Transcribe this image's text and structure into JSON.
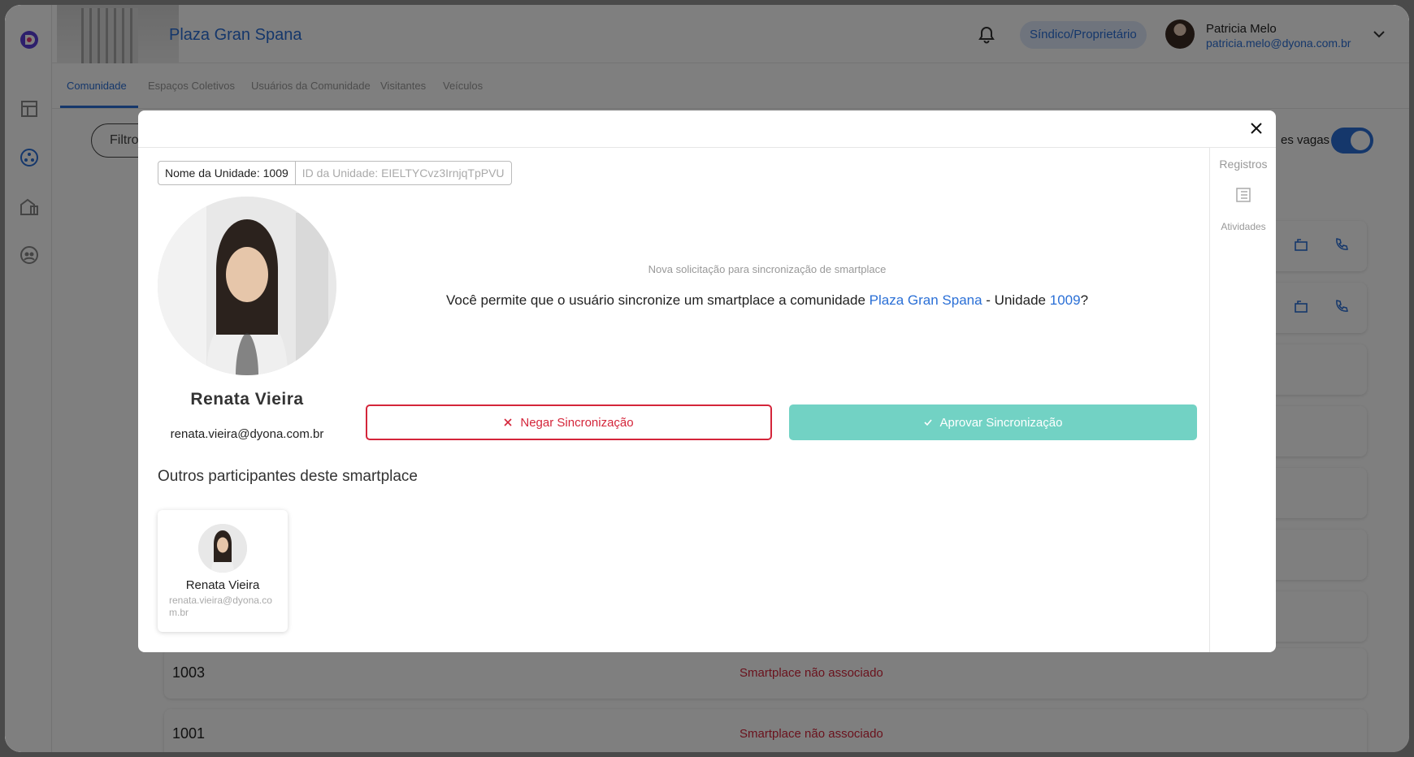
{
  "header": {
    "community_name": "Plaza Gran Spana",
    "role": "Síndico/Proprietário",
    "user_name": "Patricia Melo",
    "user_email": "patricia.melo@dyona.com.br"
  },
  "tabs": [
    {
      "label": "Comunidade",
      "active": true
    },
    {
      "label": "Espaços Coletivos",
      "active": false
    },
    {
      "label": "Usuários da Comunidade",
      "active": false
    },
    {
      "label": "Visitantes",
      "active": false
    },
    {
      "label": "Veículos",
      "active": false
    }
  ],
  "background": {
    "filter_label": "Filtro",
    "toggle_label": "es vagas",
    "rows": [
      {
        "unit": "1003",
        "status": "Smartplace não associado"
      },
      {
        "unit": "1001",
        "status": "Smartplace não associado"
      }
    ]
  },
  "modal": {
    "unit_name_tag": "Nome da Unidade: 1009",
    "unit_id_tag": "ID da Unidade: EIELTYCvz3IrnjqTpPVU",
    "person_name": "Renata  Vieira",
    "person_email": "renata.vieira@dyona.com.br",
    "request_subtitle": "Nova solicitação para sincronização de smartplace",
    "request_prefix": "Você permite que o usuário sincronize um smartplace a  comunidade ",
    "request_community": "Plaza Gran Spana",
    "request_mid": " - Unidade ",
    "request_unit": "1009",
    "request_suffix": "?",
    "deny_label": "Negar Sincronização",
    "approve_label": "Aprovar Sincronização",
    "others_title": "Outros participantes deste smartplace",
    "participants": [
      {
        "name": "Renata Vieira",
        "email": "renata.vieira@dyona.com.br"
      }
    ],
    "side_panel": {
      "registros": "Registros",
      "atividades": "Atividades"
    }
  },
  "colors": {
    "accent": "#2a6fd6",
    "danger": "#d4253a",
    "approve": "#72d2c4"
  }
}
